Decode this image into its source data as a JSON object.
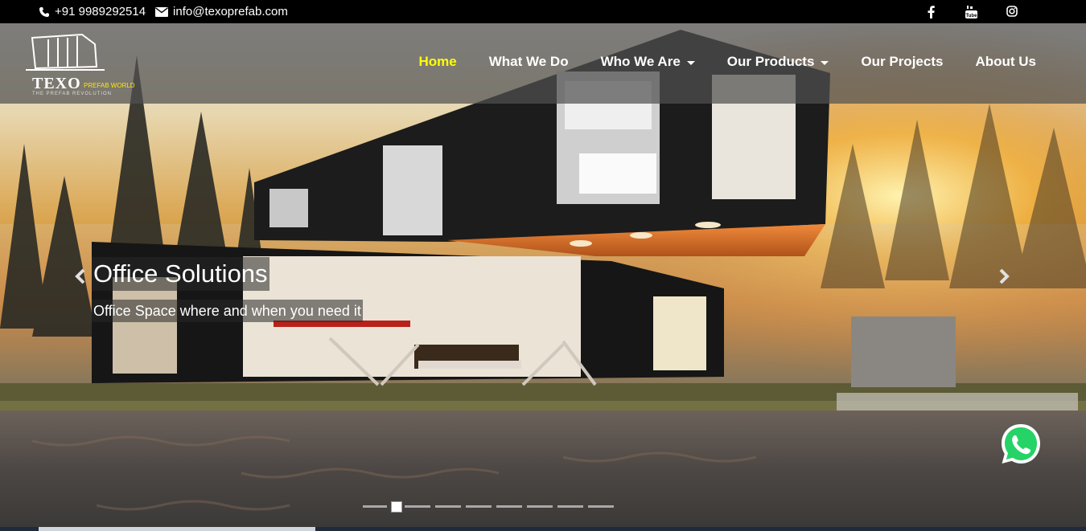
{
  "topbar": {
    "phone": "+91 9989292514",
    "email": "info@texoprefab.com",
    "social": [
      "facebook-icon",
      "youtube-icon",
      "instagram-icon"
    ]
  },
  "logo": {
    "name": "TEXO",
    "suffix": "PREFAB WORLD",
    "tagline": "THE PREFAB REVOLUTION"
  },
  "nav": {
    "items": [
      {
        "label": "Home",
        "active": true,
        "dropdown": false
      },
      {
        "label": "What We Do",
        "active": false,
        "dropdown": false
      },
      {
        "label": "Who We Are",
        "active": false,
        "dropdown": true
      },
      {
        "label": "Our Products",
        "active": false,
        "dropdown": true
      },
      {
        "label": "Our Projects",
        "active": false,
        "dropdown": false
      },
      {
        "label": "About Us",
        "active": false,
        "dropdown": false
      }
    ]
  },
  "slide": {
    "title": "Office Solutions",
    "subtitle": "Office Space where and when you need it",
    "active_index": 1,
    "count": 9
  },
  "colors": {
    "active_nav": "#ffff00",
    "header_bg": "#505050",
    "whatsapp": "#25d366"
  }
}
